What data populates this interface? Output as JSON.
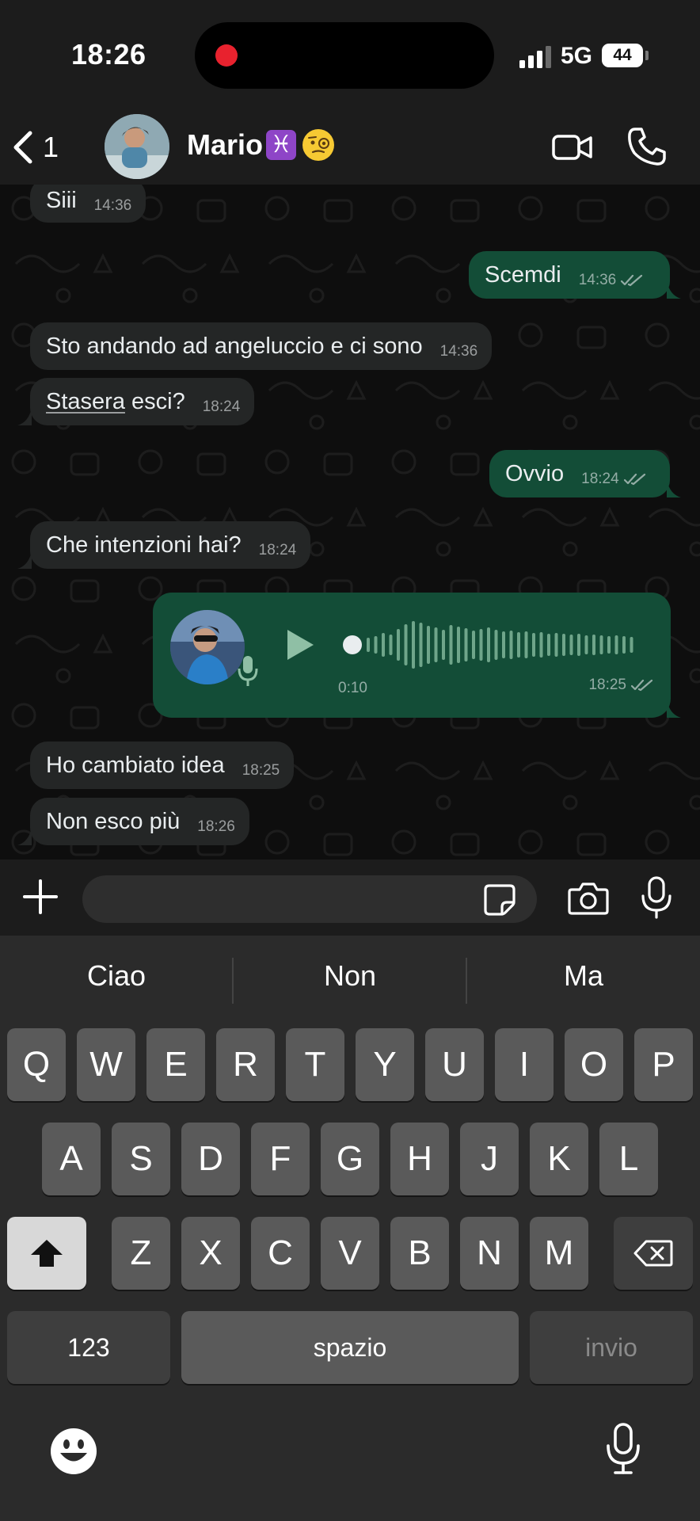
{
  "status_bar": {
    "time": "18:26",
    "network": "5G",
    "battery": "44"
  },
  "header": {
    "back_count": "1",
    "contact_name": "Mario",
    "name_emoji": "♓",
    "icons": [
      "back-chevron-icon",
      "video-call-icon",
      "phone-call-icon"
    ]
  },
  "messages": [
    {
      "direction": "in",
      "text": "Siii",
      "time": "14:36"
    },
    {
      "direction": "out",
      "text": "Scemdi",
      "time": "14:36",
      "read": true
    },
    {
      "direction": "in",
      "text": "Sto andando ad angeluccio e ci sono",
      "time": "14:36"
    },
    {
      "direction": "in",
      "text_underlined": "Stasera",
      "text": " esci?",
      "time": "18:24"
    },
    {
      "direction": "out",
      "text": "Ovvio",
      "time": "18:24",
      "read": true
    },
    {
      "direction": "in",
      "text": "Che intenzioni hai?",
      "time": "18:24"
    },
    {
      "direction": "out",
      "type": "voice",
      "duration": "0:10",
      "time": "18:25",
      "read": true,
      "progress": 0
    },
    {
      "direction": "in",
      "text": "Ho cambiato idea",
      "time": "18:25"
    },
    {
      "direction": "in",
      "text": "Non esco più",
      "time": "18:26"
    }
  ],
  "input_bar": {
    "placeholder": "",
    "icons": [
      "plus-icon",
      "sticker-icon",
      "camera-icon",
      "microphone-icon"
    ]
  },
  "keyboard": {
    "suggestions": [
      "Ciao",
      "Non",
      "Ma"
    ],
    "row1": [
      "Q",
      "W",
      "E",
      "R",
      "T",
      "Y",
      "U",
      "I",
      "O",
      "P"
    ],
    "row2": [
      "A",
      "S",
      "D",
      "F",
      "G",
      "H",
      "J",
      "K",
      "L"
    ],
    "row3": [
      "Z",
      "X",
      "C",
      "V",
      "B",
      "N",
      "M"
    ],
    "numbers_label": "123",
    "space_label": "spazio",
    "return_label": "invio"
  },
  "colors": {
    "outgoing_bubble": "#134d37",
    "incoming_bubble": "#242626",
    "accent_green": "#25d366",
    "record_indicator": "#e8222e"
  }
}
